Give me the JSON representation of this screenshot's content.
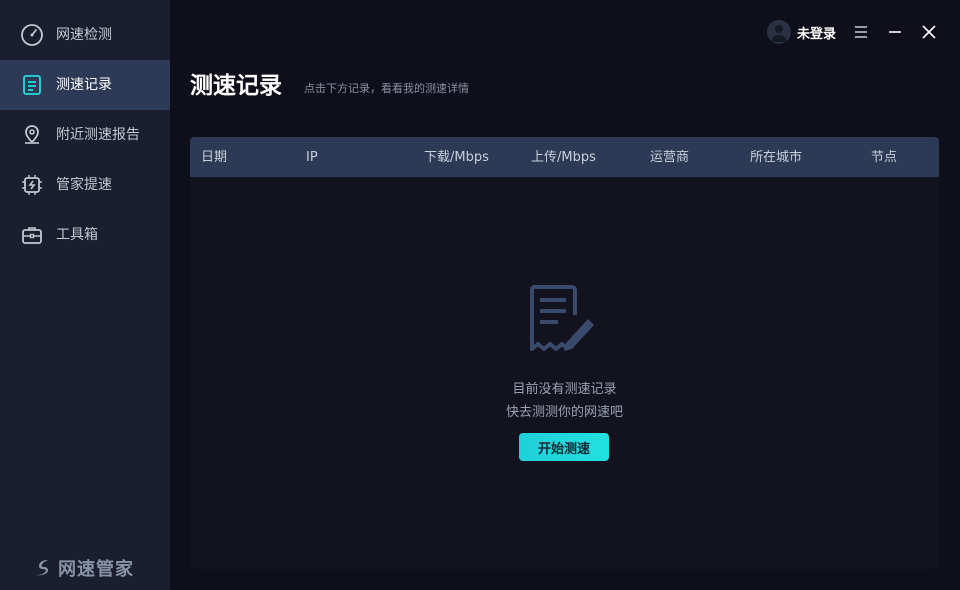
{
  "sidebar": {
    "items": [
      {
        "label": "网速检测",
        "icon": "speedometer-icon"
      },
      {
        "label": "测速记录",
        "icon": "record-list-icon"
      },
      {
        "label": "附近测速报告",
        "icon": "location-pin-icon"
      },
      {
        "label": "管家提速",
        "icon": "chip-boost-icon"
      },
      {
        "label": "工具箱",
        "icon": "toolbox-icon"
      }
    ],
    "active_index": 1,
    "logo_text": "网速管家"
  },
  "topbar": {
    "user_label": "未登录"
  },
  "page": {
    "title": "测速记录",
    "subtitle": "点击下方记录，看看我的测速详情"
  },
  "table": {
    "columns": [
      "日期",
      "IP",
      "下载/Mbps",
      "上传/Mbps",
      "运营商",
      "所在城市",
      "节点"
    ],
    "rows": []
  },
  "empty_state": {
    "line1": "目前没有测速记录",
    "line2": "快去测测你的网速吧",
    "button_label": "开始测速"
  },
  "colors": {
    "accent": "#1fd0d8",
    "sidebar_bg": "#1a1e2e",
    "active_bg": "#2c3a56",
    "content_bg": "#0f0f1b"
  }
}
